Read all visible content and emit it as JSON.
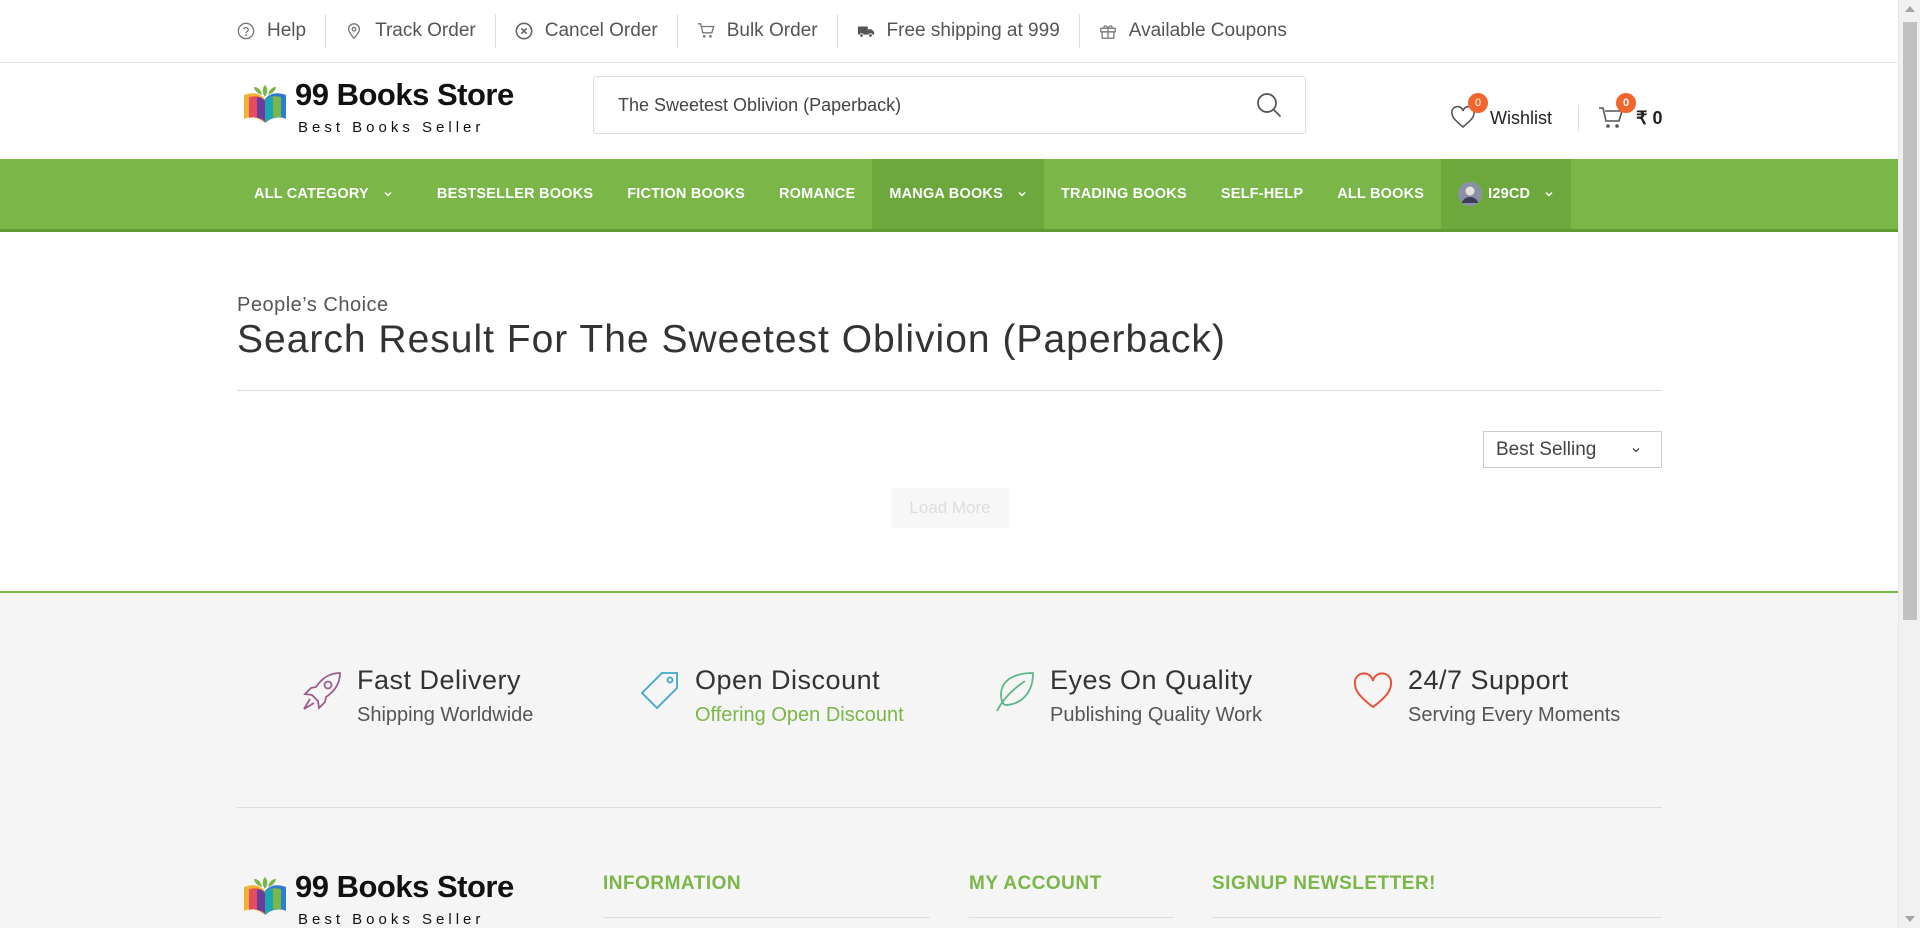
{
  "topbar": {
    "items": [
      {
        "label": "Help",
        "icon": "help-circle-icon"
      },
      {
        "label": "Track Order",
        "icon": "map-pin-icon"
      },
      {
        "label": "Cancel Order",
        "icon": "cancel-circle-icon"
      },
      {
        "label": "Bulk Order",
        "icon": "cart-icon"
      },
      {
        "label": "Free shipping at 999",
        "icon": "truck-icon"
      },
      {
        "label": "Available Coupons",
        "icon": "gift-icon"
      }
    ]
  },
  "header": {
    "logo_name": "99 Books Store",
    "logo_tagline": "Best Books Seller",
    "search_value": "The Sweetest Oblivion (Paperback)",
    "wishlist_label": "Wishlist",
    "wishlist_count": "0",
    "cart_count": "0",
    "cart_total": "₹ 0"
  },
  "nav": {
    "items": [
      {
        "label": "ALL CATEGORY",
        "dropdown": true
      },
      {
        "label": "BESTSELLER BOOKS"
      },
      {
        "label": "FICTION BOOKS"
      },
      {
        "label": "ROMANCE"
      },
      {
        "label": "MANGA BOOKS",
        "dropdown": true
      },
      {
        "label": "TRADING BOOKS"
      },
      {
        "label": "SELF-HELP"
      },
      {
        "label": "ALL BOOKS"
      },
      {
        "label": "I29CD",
        "dropdown": true
      }
    ]
  },
  "content": {
    "kicker": "People’s Choice",
    "title": "Search Result For The Sweetest Oblivion (Paperback)",
    "sort_value": "Best Selling",
    "load_more": "Load More"
  },
  "features": [
    {
      "title": "Fast Delivery",
      "subtitle": "Shipping Worldwide",
      "icon": "rocket-icon"
    },
    {
      "title": "Open Discount",
      "subtitle": "Offering Open Discount",
      "icon": "tag-icon"
    },
    {
      "title": "Eyes On Quality",
      "subtitle": "Publishing Quality Work",
      "icon": "leaf-icon"
    },
    {
      "title": "24/7 Support",
      "subtitle": "Serving Every Moments",
      "icon": "heart-icon"
    }
  ],
  "footer": {
    "logo_name": "99 Books Store",
    "logo_tagline": "Best Books Seller",
    "col_information": "INFORMATION",
    "col_account": "MY ACCOUNT",
    "col_newsletter": "SIGNUP NEWSLETTER!"
  },
  "colors": {
    "brand_green": "#7ab648",
    "badge_orange": "#f2652d"
  }
}
